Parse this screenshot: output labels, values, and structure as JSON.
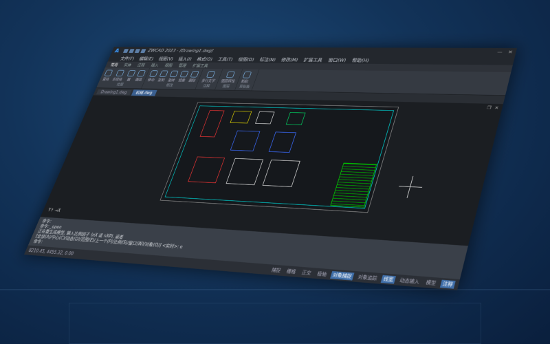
{
  "titlebar": {
    "title": "ZWCAD 2023 - [Drawing1.dwg]"
  },
  "menu": [
    "文件(F)",
    "编辑(E)",
    "视图(V)",
    "插入(I)",
    "格式(O)",
    "工具(T)",
    "绘图(D)",
    "标注(N)",
    "修改(M)",
    "扩展工具",
    "窗口(W)",
    "帮助(H)"
  ],
  "ribbon_tabs": [
    "常用",
    "实体",
    "注释",
    "插入",
    "视图",
    "管理",
    "扩展工具"
  ],
  "ribbon_groups": [
    {
      "label": "绘图",
      "tools": [
        "直线",
        "多段线",
        "圆",
        "圆弧"
      ]
    },
    {
      "label": "修改",
      "tools": [
        "移动",
        "复制",
        "旋转",
        "镜像",
        "删除"
      ]
    },
    {
      "label": "注释",
      "tools": [
        "多行文字"
      ]
    },
    {
      "label": "图层",
      "tools": [
        "图层特性"
      ]
    },
    {
      "label": "剪贴板",
      "tools": [
        "粘贴"
      ]
    }
  ],
  "doc_tabs": [
    "Drawing1.dwg",
    "机械.dwg"
  ],
  "command_lines": [
    "命令:",
    "命令: _open",
    "正在重生成模型, 输入比例因子 (nX 或 nXP), 或者",
    "[全部(A)/中心(C)/动态(D)/范围(E)/上一个(P)/比例(S)/窗口(W)/对象(O)] <实时>: e",
    "命令:"
  ],
  "status": {
    "coords": "8210.45, 4455.32, 0.00",
    "buttons": [
      "捕捉",
      "栅格",
      "正交",
      "极轴",
      "对象捕捉",
      "对象追踪",
      "线宽",
      "动态输入",
      "模型",
      "注释"
    ],
    "active": [
      4,
      6,
      9
    ]
  }
}
